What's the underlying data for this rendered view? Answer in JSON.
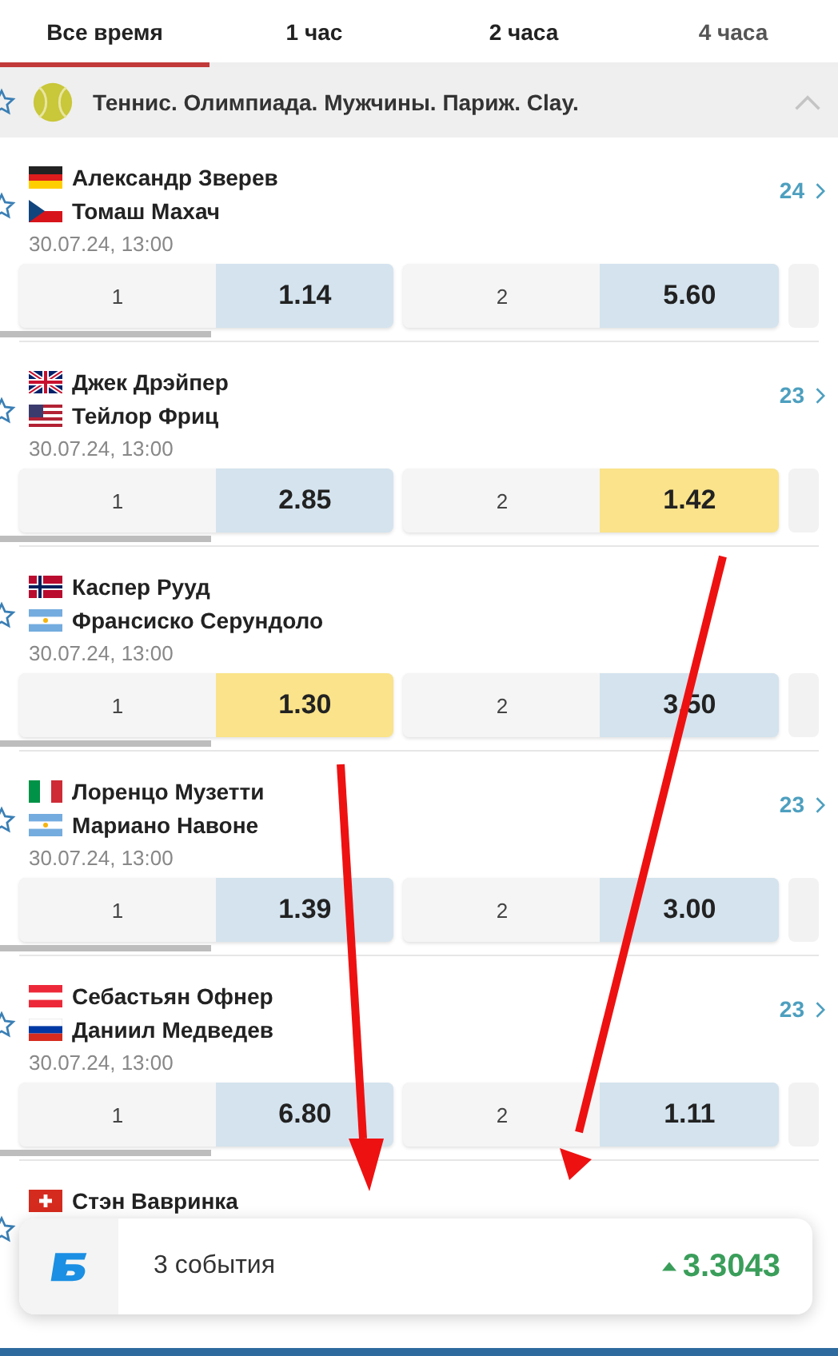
{
  "tabs": [
    {
      "label": "Все время",
      "selected": true
    },
    {
      "label": "1 час",
      "selected": false
    },
    {
      "label": "2 часа",
      "selected": false
    },
    {
      "label": "4 часа",
      "selected": false
    }
  ],
  "section": {
    "title": "Теннис. Олимпиада. Мужчины. Париж. Clay.",
    "expanded": true
  },
  "matches": [
    {
      "players": [
        {
          "name": "Александр Зверев",
          "kind": "de"
        },
        {
          "name": "Томаш Махач",
          "kind": "cz"
        }
      ],
      "date": "30.07.24, 13:00",
      "markets": "24",
      "odds": [
        {
          "label": "1",
          "value": "1.14",
          "selected": false
        },
        {
          "label": "2",
          "value": "5.60",
          "selected": false
        }
      ]
    },
    {
      "players": [
        {
          "name": "Джек Дрэйпер",
          "kind": "gb"
        },
        {
          "name": "Тейлор Фриц",
          "kind": "us"
        }
      ],
      "date": "30.07.24, 13:00",
      "markets": "23",
      "odds": [
        {
          "label": "1",
          "value": "2.85",
          "selected": false
        },
        {
          "label": "2",
          "value": "1.42",
          "selected": true
        }
      ]
    },
    {
      "players": [
        {
          "name": "Каспер Рууд",
          "kind": "no"
        },
        {
          "name": "Франсиско Серундоло",
          "kind": "ar"
        }
      ],
      "date": "30.07.24, 13:00",
      "odds": [
        {
          "label": "1",
          "value": "1.30",
          "selected": true
        },
        {
          "label": "2",
          "value": "3.50",
          "selected": false
        }
      ]
    },
    {
      "players": [
        {
          "name": "Лоренцо Музетти",
          "kind": "it"
        },
        {
          "name": "Мариано Навоне",
          "kind": "ar"
        }
      ],
      "date": "30.07.24, 13:00",
      "markets": "23",
      "odds": [
        {
          "label": "1",
          "value": "1.39",
          "selected": false
        },
        {
          "label": "2",
          "value": "3.00",
          "selected": false
        }
      ]
    },
    {
      "players": [
        {
          "name": "Себастьян Офнер",
          "kind": "at"
        },
        {
          "name": "Даниил Медведев",
          "kind": "ru"
        }
      ],
      "date": "30.07.24, 13:00",
      "markets": "23",
      "odds": [
        {
          "label": "1",
          "value": "6.80",
          "selected": false
        },
        {
          "label": "2",
          "value": "1.11",
          "selected": false
        }
      ]
    },
    {
      "players": [
        {
          "name": "Стэн Вавринка",
          "kind": "ch"
        }
      ]
    }
  ],
  "bet_slip": {
    "count": "3 события",
    "total": "3.3043"
  }
}
